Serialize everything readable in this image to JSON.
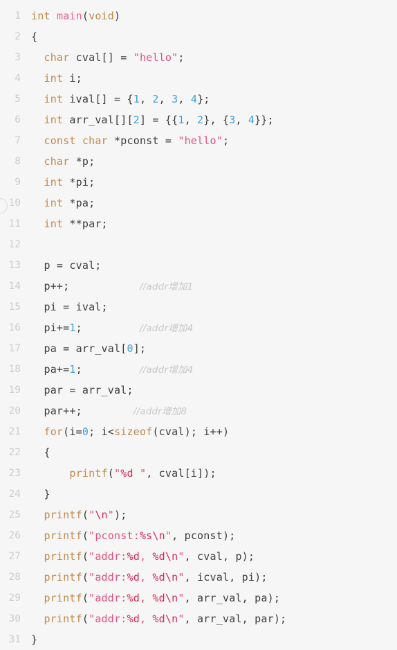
{
  "editor": {
    "language": "c",
    "first_line": 1,
    "last_line": 31,
    "background_color": "#f6f6f6",
    "gutter_color": "#cdcdcd",
    "theme_colors": {
      "keyword": "#c08a4a",
      "function": "#e8628c",
      "string": "#e0527c",
      "format_specifier": "#d62a53",
      "number": "#3e9fd6",
      "identifier": "#3c3c3c",
      "comment": "#c8c8c8"
    }
  },
  "lines": [
    {
      "n": "1",
      "tokens": [
        {
          "t": "kw",
          "v": "int"
        },
        {
          "t": "id",
          "v": " "
        },
        {
          "t": "fn",
          "v": "main"
        },
        {
          "t": "punc",
          "v": "("
        },
        {
          "t": "kw",
          "v": "void"
        },
        {
          "t": "punc",
          "v": ")"
        }
      ]
    },
    {
      "n": "2",
      "tokens": [
        {
          "t": "punc",
          "v": "{"
        }
      ]
    },
    {
      "n": "3",
      "tokens": [
        {
          "t": "id",
          "v": "  "
        },
        {
          "t": "kw",
          "v": "char"
        },
        {
          "t": "id",
          "v": " cval[] = "
        },
        {
          "t": "str",
          "v": "\"hello\""
        },
        {
          "t": "punc",
          "v": ";"
        }
      ]
    },
    {
      "n": "4",
      "tokens": [
        {
          "t": "id",
          "v": "  "
        },
        {
          "t": "kw",
          "v": "int"
        },
        {
          "t": "id",
          "v": " i;"
        }
      ]
    },
    {
      "n": "5",
      "tokens": [
        {
          "t": "id",
          "v": "  "
        },
        {
          "t": "kw",
          "v": "int"
        },
        {
          "t": "id",
          "v": " ival[] = {"
        },
        {
          "t": "num",
          "v": "1"
        },
        {
          "t": "id",
          "v": ", "
        },
        {
          "t": "num",
          "v": "2"
        },
        {
          "t": "id",
          "v": ", "
        },
        {
          "t": "num",
          "v": "3"
        },
        {
          "t": "id",
          "v": ", "
        },
        {
          "t": "num",
          "v": "4"
        },
        {
          "t": "punc",
          "v": "};"
        }
      ]
    },
    {
      "n": "6",
      "tokens": [
        {
          "t": "id",
          "v": "  "
        },
        {
          "t": "kw",
          "v": "int"
        },
        {
          "t": "id",
          "v": " arr_val[]["
        },
        {
          "t": "num",
          "v": "2"
        },
        {
          "t": "id",
          "v": "] = {{"
        },
        {
          "t": "num",
          "v": "1"
        },
        {
          "t": "id",
          "v": ", "
        },
        {
          "t": "num",
          "v": "2"
        },
        {
          "t": "id",
          "v": "}, {"
        },
        {
          "t": "num",
          "v": "3"
        },
        {
          "t": "id",
          "v": ", "
        },
        {
          "t": "num",
          "v": "4"
        },
        {
          "t": "punc",
          "v": "}};"
        }
      ]
    },
    {
      "n": "7",
      "tokens": [
        {
          "t": "id",
          "v": "  "
        },
        {
          "t": "kw",
          "v": "const"
        },
        {
          "t": "id",
          "v": " "
        },
        {
          "t": "kw",
          "v": "char"
        },
        {
          "t": "id",
          "v": " *pconst = "
        },
        {
          "t": "str",
          "v": "\"hello\""
        },
        {
          "t": "punc",
          "v": ";"
        }
      ]
    },
    {
      "n": "8",
      "tokens": [
        {
          "t": "id",
          "v": "  "
        },
        {
          "t": "kw",
          "v": "char"
        },
        {
          "t": "id",
          "v": " *p;"
        }
      ]
    },
    {
      "n": "9",
      "tokens": [
        {
          "t": "id",
          "v": "  "
        },
        {
          "t": "kw",
          "v": "int"
        },
        {
          "t": "id",
          "v": " *pi;"
        }
      ]
    },
    {
      "n": "10",
      "tokens": [
        {
          "t": "id",
          "v": "  "
        },
        {
          "t": "kw",
          "v": "int"
        },
        {
          "t": "id",
          "v": " *pa;"
        }
      ]
    },
    {
      "n": "11",
      "tokens": [
        {
          "t": "id",
          "v": "  "
        },
        {
          "t": "kw",
          "v": "int"
        },
        {
          "t": "id",
          "v": " **par;"
        }
      ]
    },
    {
      "n": "12",
      "tokens": []
    },
    {
      "n": "13",
      "tokens": [
        {
          "t": "id",
          "v": "  p = cval;"
        }
      ]
    },
    {
      "n": "14",
      "tokens": [
        {
          "t": "id",
          "v": "  p++;"
        },
        {
          "t": "pad",
          "v": "           "
        },
        {
          "t": "cmt",
          "v": "//addr增加1"
        }
      ]
    },
    {
      "n": "15",
      "tokens": [
        {
          "t": "id",
          "v": "  pi = ival;"
        }
      ]
    },
    {
      "n": "16",
      "tokens": [
        {
          "t": "id",
          "v": "  pi+="
        },
        {
          "t": "num",
          "v": "1"
        },
        {
          "t": "id",
          "v": ";"
        },
        {
          "t": "pad",
          "v": "         "
        },
        {
          "t": "cmt",
          "v": "//addr增加4"
        }
      ]
    },
    {
      "n": "17",
      "tokens": [
        {
          "t": "id",
          "v": "  pa = arr_val["
        },
        {
          "t": "num",
          "v": "0"
        },
        {
          "t": "id",
          "v": "];"
        }
      ]
    },
    {
      "n": "18",
      "tokens": [
        {
          "t": "id",
          "v": "  pa+="
        },
        {
          "t": "num",
          "v": "1"
        },
        {
          "t": "id",
          "v": ";"
        },
        {
          "t": "pad",
          "v": "         "
        },
        {
          "t": "cmt",
          "v": "//addr增加4"
        }
      ]
    },
    {
      "n": "19",
      "tokens": [
        {
          "t": "id",
          "v": "  par = arr_val;"
        }
      ]
    },
    {
      "n": "20",
      "tokens": [
        {
          "t": "id",
          "v": "  par++;"
        },
        {
          "t": "pad",
          "v": "        "
        },
        {
          "t": "cmt",
          "v": "//addr增加8"
        }
      ]
    },
    {
      "n": "21",
      "tokens": [
        {
          "t": "id",
          "v": "  "
        },
        {
          "t": "kw",
          "v": "for"
        },
        {
          "t": "id",
          "v": "(i="
        },
        {
          "t": "num",
          "v": "0"
        },
        {
          "t": "id",
          "v": "; i<"
        },
        {
          "t": "kw",
          "v": "sizeof"
        },
        {
          "t": "id",
          "v": "(cval); i++)"
        }
      ]
    },
    {
      "n": "22",
      "tokens": [
        {
          "t": "punc",
          "v": "  {"
        }
      ]
    },
    {
      "n": "23",
      "tokens": [
        {
          "t": "id",
          "v": "      "
        },
        {
          "t": "kw",
          "v": "printf"
        },
        {
          "t": "punc",
          "v": "("
        },
        {
          "t": "str",
          "v": "\""
        },
        {
          "t": "fmt",
          "v": "%d"
        },
        {
          "t": "str",
          "v": " \""
        },
        {
          "t": "id",
          "v": ", cval[i]);"
        }
      ]
    },
    {
      "n": "24",
      "tokens": [
        {
          "t": "punc",
          "v": "  }"
        }
      ]
    },
    {
      "n": "25",
      "tokens": [
        {
          "t": "id",
          "v": "  "
        },
        {
          "t": "kw",
          "v": "printf"
        },
        {
          "t": "punc",
          "v": "("
        },
        {
          "t": "str",
          "v": "\""
        },
        {
          "t": "fmt",
          "v": "\\n"
        },
        {
          "t": "str",
          "v": "\""
        },
        {
          "t": "id",
          "v": ");"
        }
      ]
    },
    {
      "n": "26",
      "tokens": [
        {
          "t": "id",
          "v": "  "
        },
        {
          "t": "kw",
          "v": "printf"
        },
        {
          "t": "punc",
          "v": "("
        },
        {
          "t": "str",
          "v": "\"pconst:"
        },
        {
          "t": "fmt",
          "v": "%s\\n"
        },
        {
          "t": "str",
          "v": "\""
        },
        {
          "t": "id",
          "v": ", pconst);"
        }
      ]
    },
    {
      "n": "27",
      "tokens": [
        {
          "t": "id",
          "v": "  "
        },
        {
          "t": "kw",
          "v": "printf"
        },
        {
          "t": "punc",
          "v": "("
        },
        {
          "t": "str",
          "v": "\"addr:"
        },
        {
          "t": "fmt",
          "v": "%d"
        },
        {
          "t": "str",
          "v": ", "
        },
        {
          "t": "fmt",
          "v": "%d\\n"
        },
        {
          "t": "str",
          "v": "\""
        },
        {
          "t": "id",
          "v": ", cval, p);"
        }
      ]
    },
    {
      "n": "28",
      "tokens": [
        {
          "t": "id",
          "v": "  "
        },
        {
          "t": "kw",
          "v": "printf"
        },
        {
          "t": "punc",
          "v": "("
        },
        {
          "t": "str",
          "v": "\"addr:"
        },
        {
          "t": "fmt",
          "v": "%d"
        },
        {
          "t": "str",
          "v": ", "
        },
        {
          "t": "fmt",
          "v": "%d\\n"
        },
        {
          "t": "str",
          "v": "\""
        },
        {
          "t": "id",
          "v": ", icval, pi);"
        }
      ]
    },
    {
      "n": "29",
      "tokens": [
        {
          "t": "id",
          "v": "  "
        },
        {
          "t": "kw",
          "v": "printf"
        },
        {
          "t": "punc",
          "v": "("
        },
        {
          "t": "str",
          "v": "\"addr:"
        },
        {
          "t": "fmt",
          "v": "%d"
        },
        {
          "t": "str",
          "v": ", "
        },
        {
          "t": "fmt",
          "v": "%d\\n"
        },
        {
          "t": "str",
          "v": "\""
        },
        {
          "t": "id",
          "v": ", arr_val, pa);"
        }
      ]
    },
    {
      "n": "30",
      "tokens": [
        {
          "t": "id",
          "v": "  "
        },
        {
          "t": "kw",
          "v": "printf"
        },
        {
          "t": "punc",
          "v": "("
        },
        {
          "t": "str",
          "v": "\"addr:"
        },
        {
          "t": "fmt",
          "v": "%d"
        },
        {
          "t": "str",
          "v": ", "
        },
        {
          "t": "fmt",
          "v": "%d\\n"
        },
        {
          "t": "str",
          "v": "\""
        },
        {
          "t": "id",
          "v": ", arr_val, par);"
        }
      ]
    },
    {
      "n": "31",
      "tokens": [
        {
          "t": "punc",
          "v": "}"
        }
      ]
    }
  ]
}
